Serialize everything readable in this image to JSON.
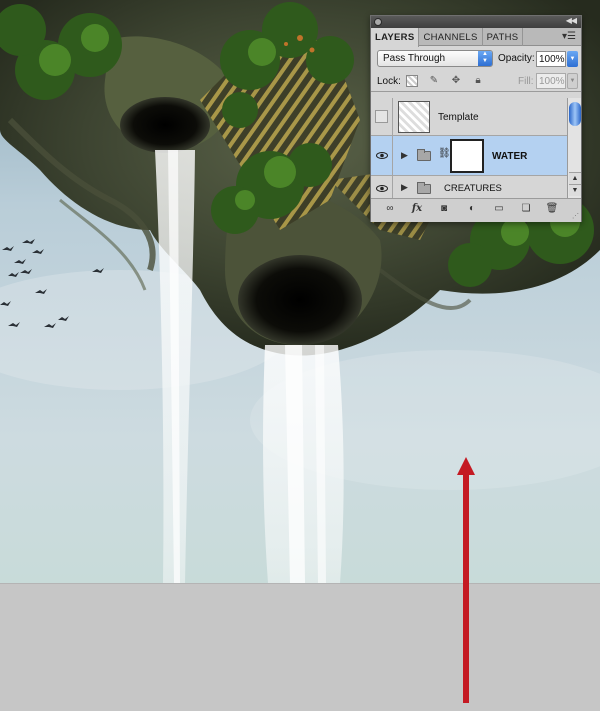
{
  "panel": {
    "tabs": [
      {
        "label": "LAYERS"
      },
      {
        "label": "CHANNELS"
      },
      {
        "label": "PATHS"
      }
    ],
    "blend_mode": "Pass Through",
    "opacity_label": "Opacity:",
    "opacity_value": "100%",
    "lock_label": "Lock:",
    "fill_label": "Fill:",
    "fill_value": "100%",
    "layers": [
      {
        "name": "Template",
        "visible": false,
        "selected": false
      },
      {
        "name": "WATER",
        "visible": true,
        "selected": true
      },
      {
        "name": "CREATURES",
        "visible": true,
        "selected": false
      }
    ],
    "footer_icons": [
      "link-layers-icon",
      "fx-icon",
      "layer-mask-icon",
      "adjustment-layer-icon",
      "new-group-icon",
      "new-layer-icon",
      "trash-icon"
    ]
  },
  "colors": {
    "selected_row": "#b4d1f1",
    "annotation_arrow": "#c41a23",
    "sky": "#c4d6df",
    "canvas_background": "#c6c6c6"
  }
}
